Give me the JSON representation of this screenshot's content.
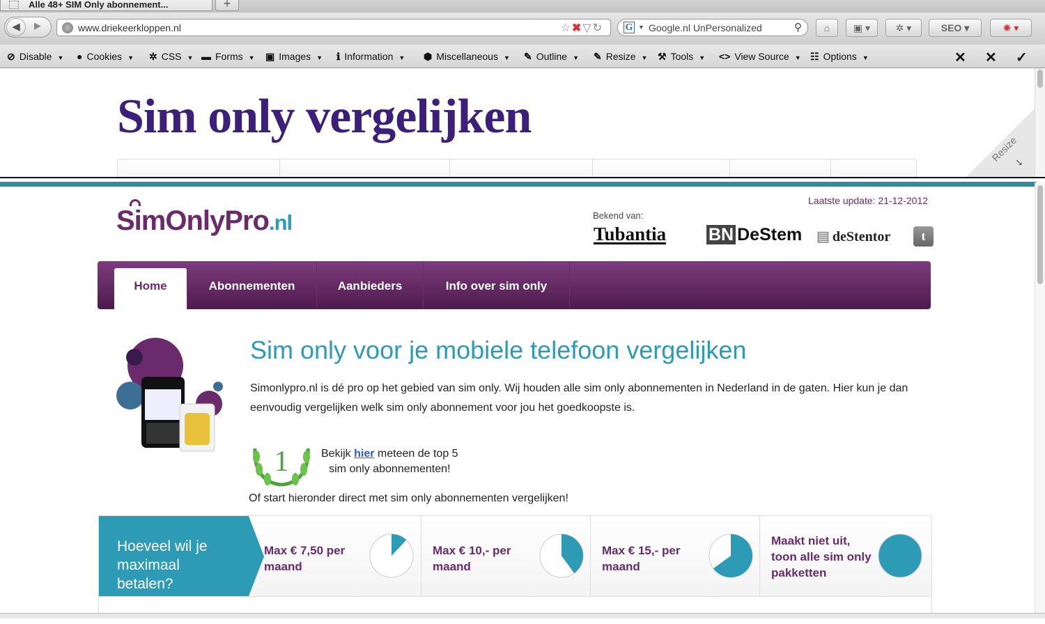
{
  "browser": {
    "tab_title": "Alle 48+ SIM Only abonnement...",
    "new_tab": "+",
    "url": "www.driekeerkloppen.nl",
    "search_text": "Google.nl UnPersonalized",
    "seo_label": "SEO"
  },
  "devtoolbar": {
    "items": [
      "Disable",
      "Cookies",
      "CSS",
      "Forms",
      "Images",
      "Information",
      "Miscellaneous",
      "Outline",
      "Resize",
      "Tools",
      "View Source",
      "Options"
    ],
    "right_buttons": [
      "✕",
      "✕",
      "✓"
    ]
  },
  "old_page": {
    "title": "Sim only vergelijken",
    "resize_label": "Resize"
  },
  "site": {
    "logo_main": "SimOnlyPro",
    "logo_tld": ".nl",
    "last_update": "Laatste update: 21-12-2012",
    "known_from": "Bekend van:",
    "press": [
      "Tubantia",
      "BN",
      "DeStem",
      "deStentor"
    ],
    "nav": [
      "Home",
      "Abonnementen",
      "Aanbieders",
      "Info over sim only"
    ],
    "hero_title": "Sim only voor je mobiele telefoon vergelijken",
    "hero_text": "Simonlypro.nl is dé pro op het gebied van sim only. Wij houden alle sim only abonnementen in Nederland in de gaten. Hier kun je dan eenvoudig vergelijken welk sim only abonnement voor jou het goedkoopste is.",
    "top5_prefix": "Bekijk ",
    "top5_link": "hier",
    "top5_suffix": " meteen de top 5",
    "top5_line2": "sim only abonnementen!",
    "top5_badge": "1",
    "start_text": "Of start hieronder direct met sim only abonnementen vergelijken!",
    "compare_question": "Hoeveel wil je maximaal betalen?",
    "compare_options": [
      {
        "label": "Max € 7,50 per maand",
        "fill": 0.12
      },
      {
        "label": "Max € 10,- per maand",
        "fill": 0.4
      },
      {
        "label": "Max € 15,- per maand",
        "fill": 0.65
      },
      {
        "label": "Maakt niet uit, toon alle sim only pakketten",
        "fill": 1.0
      }
    ]
  },
  "colors": {
    "purple": "#6b2a6b",
    "teal": "#2e9bb6",
    "title_purple": "#3b1f78"
  }
}
